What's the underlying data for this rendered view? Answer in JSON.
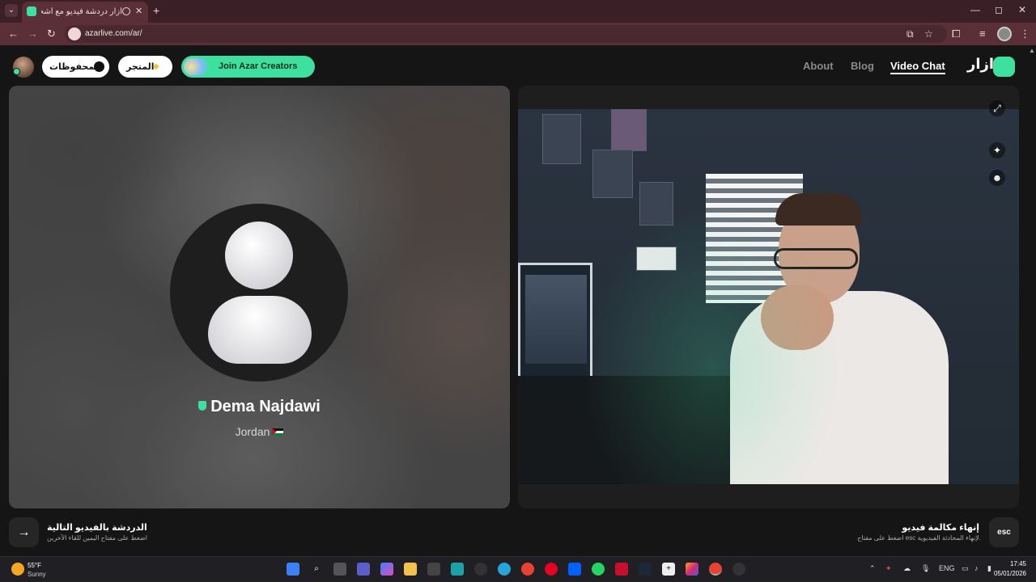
{
  "browser": {
    "tab_title": "أزار دردشة فيديو مع أشخاص",
    "tab_close": "✕",
    "new_tab": "+",
    "url": "azarlive.com/ar/",
    "window_controls": [
      "—",
      "◻",
      "✕"
    ]
  },
  "header": {
    "saved_label": "المحفوظات",
    "shop_label": "المتجر",
    "creators_label": "Join Azar Creators",
    "nav": [
      {
        "label": "About",
        "active": false
      },
      {
        "label": "Blog",
        "active": false
      },
      {
        "label": "Video Chat",
        "active": true
      }
    ],
    "logo_text": "ازار"
  },
  "partner": {
    "name": "Dema Najdawi",
    "country": "Jordan",
    "verified_icon": "shield-icon",
    "flag_icon": "jordan-flag-icon"
  },
  "self_view": {
    "controls": [
      "expand-icon",
      "sparkle-effects-icon",
      "face-filter-icon"
    ]
  },
  "controls": {
    "next_title": "الدردشة بالفيديو التالية",
    "next_sub": "اضغط على مفتاح اليمين للقاء الآخرين",
    "next_icon": "→",
    "end_title": "إنهاء مكالمة فيديو",
    "end_sub": "اضغط على مفتاح esc لإنهاء المحادثة الفيديوية.",
    "esc_label": "esc"
  },
  "taskbar": {
    "temp": "55°F",
    "condition": "Sunny",
    "lang": "ENG",
    "time": "17:45",
    "date": "05/01/2026"
  },
  "colors": {
    "accent": "#3ee0a0",
    "tab_bar": "#3a1f26",
    "address_bar": "#5a2f38"
  }
}
